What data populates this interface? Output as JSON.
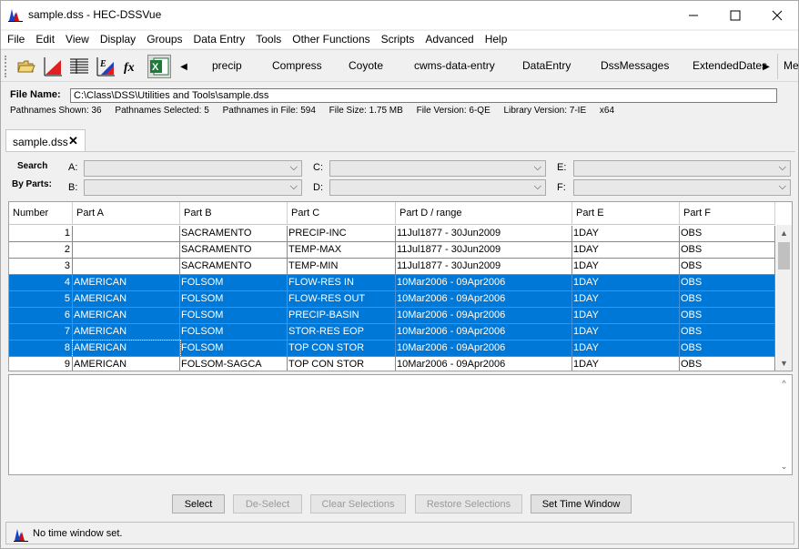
{
  "window": {
    "title": "sample.dss - HEC-DSSVue"
  },
  "menu": [
    "File",
    "Edit",
    "View",
    "Display",
    "Groups",
    "Data Entry",
    "Tools",
    "Other Functions",
    "Scripts",
    "Advanced",
    "Help"
  ],
  "toolbar": {
    "scripts": [
      "precip",
      "Compress",
      "Coyote",
      "cwms-data-entry",
      "DataEntry",
      "DssMessages",
      "ExtendedDates",
      "Me"
    ]
  },
  "file": {
    "label": "File Name:",
    "path": "C:\\Class\\DSS\\Utilities and Tools\\sample.dss"
  },
  "stats": {
    "shown": "Pathnames Shown:  36",
    "selected": "Pathnames Selected: 5",
    "infile": "Pathnames in File:  594",
    "size": "File Size:  1.75  MB",
    "version": "File Version: 6-QE",
    "library": "Library Version: 7-IE",
    "arch": "x64"
  },
  "tab": {
    "label": "sample.dss"
  },
  "search": {
    "label1": "Search",
    "label2": "By Parts:",
    "parts": [
      "A:",
      "B:",
      "C:",
      "D:",
      "E:",
      "F:"
    ]
  },
  "table": {
    "headers": [
      "Number",
      "Part A",
      "Part B",
      "Part C",
      "Part D / range",
      "Part E",
      "Part F"
    ],
    "rows": [
      [
        "1",
        "",
        "SACRAMENTO",
        "PRECIP-INC",
        "11Jul1877 - 30Jun2009",
        "1DAY",
        "OBS"
      ],
      [
        "2",
        "",
        "SACRAMENTO",
        "TEMP-MAX",
        "11Jul1877 - 30Jun2009",
        "1DAY",
        "OBS"
      ],
      [
        "3",
        "",
        "SACRAMENTO",
        "TEMP-MIN",
        "11Jul1877 - 30Jun2009",
        "1DAY",
        "OBS"
      ],
      [
        "4",
        "AMERICAN",
        "FOLSOM",
        "FLOW-RES IN",
        "10Mar2006 - 09Apr2006",
        "1DAY",
        "OBS"
      ],
      [
        "5",
        "AMERICAN",
        "FOLSOM",
        "FLOW-RES OUT",
        "10Mar2006 - 09Apr2006",
        "1DAY",
        "OBS"
      ],
      [
        "6",
        "AMERICAN",
        "FOLSOM",
        "PRECIP-BASIN",
        "10Mar2006 - 09Apr2006",
        "1DAY",
        "OBS"
      ],
      [
        "7",
        "AMERICAN",
        "FOLSOM",
        "STOR-RES EOP",
        "10Mar2006 - 09Apr2006",
        "1DAY",
        "OBS"
      ],
      [
        "8",
        "AMERICAN",
        "FOLSOM",
        "TOP CON STOR",
        "10Mar2006 - 09Apr2006",
        "1DAY",
        "OBS"
      ],
      [
        "9",
        "AMERICAN",
        "FOLSOM-SAGCA",
        "TOP CON STOR",
        "10Mar2006 - 09Apr2006",
        "1DAY",
        "OBS"
      ]
    ],
    "selected_rows": [
      4,
      5,
      6,
      7,
      8
    ]
  },
  "buttons": {
    "select": "Select",
    "deselect": "De-Select",
    "clear": "Clear Selections",
    "restore": "Restore Selections",
    "timewindow": "Set Time Window"
  },
  "status": {
    "text": "No time window set."
  },
  "colors": {
    "selection": "#0078d7",
    "excel_green": "#1d7a3a"
  }
}
